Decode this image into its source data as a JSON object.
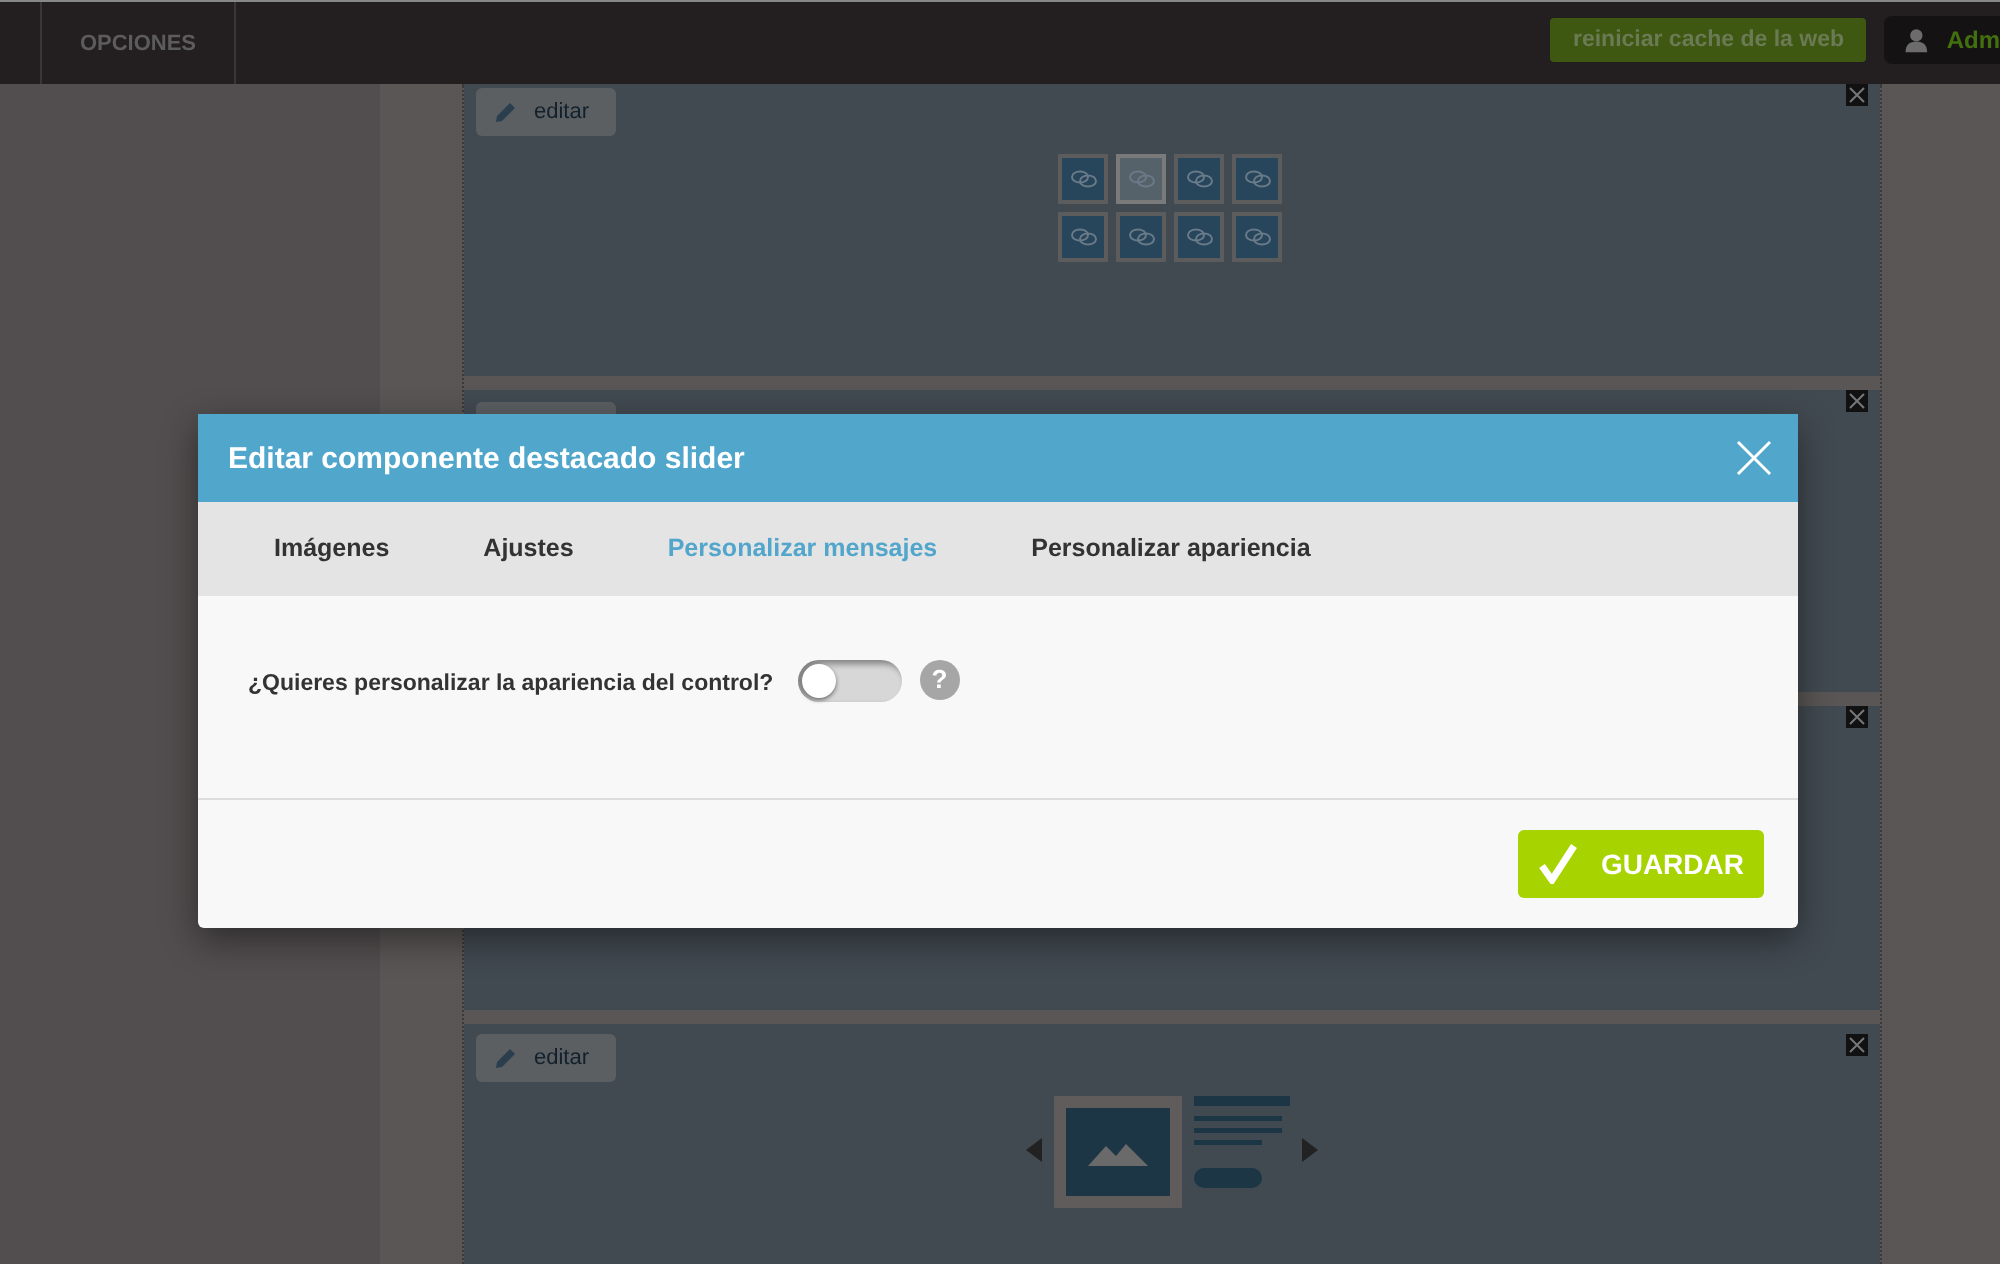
{
  "topbar": {
    "menu_item": "OPCIONES",
    "cache_button": "reiniciar cache de la web",
    "user_button": "Adm"
  },
  "components": [
    {
      "kind": "gallery",
      "edit_label": "editar",
      "tiles": [
        {
          "selected": false
        },
        {
          "selected": true
        },
        {
          "selected": false
        },
        {
          "selected": false
        },
        {
          "selected": false
        },
        {
          "selected": false
        },
        {
          "selected": false
        },
        {
          "selected": false
        }
      ]
    },
    {
      "kind": "covered"
    },
    {
      "kind": "covered"
    },
    {
      "kind": "slider",
      "edit_label": "editar"
    }
  ],
  "dialog": {
    "title": "Editar componente destacado slider",
    "tabs": [
      {
        "label": "Imágenes",
        "selected": false
      },
      {
        "label": "Ajustes",
        "selected": false
      },
      {
        "label": "Personalizar mensajes",
        "selected": true
      },
      {
        "label": "Personalizar apariencia",
        "selected": false
      }
    ],
    "question": "¿Quieres personalizar la apariencia del control?",
    "toggle": {
      "on": false
    },
    "help": "?",
    "save_button": "GUARDAR"
  }
}
